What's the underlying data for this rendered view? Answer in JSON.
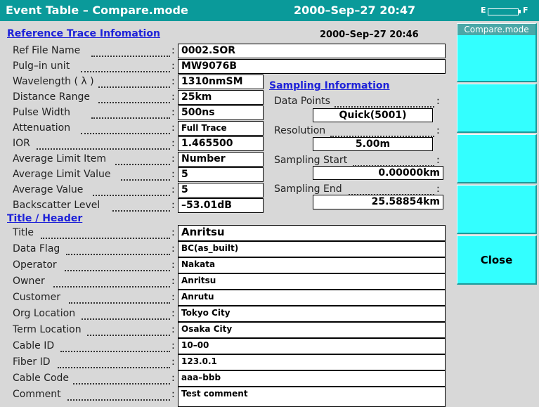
{
  "titlebar": {
    "title": "Event Table – Compare.mode",
    "datetime": "2000–Sep–27 20:47",
    "battery": {
      "left": "E",
      "right": "F"
    }
  },
  "reference": {
    "heading": "Reference Trace Infomation",
    "date": "2000–Sep–27  20:46",
    "fields": [
      {
        "label": "Ref File Name",
        "value": "0002.SOR"
      },
      {
        "label": "Pulg–in unit",
        "value": "MW9076B"
      },
      {
        "label": "Wavelength ( λ )",
        "value": "1310nmSM"
      },
      {
        "label": "Distance Range",
        "value": "25km"
      },
      {
        "label": "Pulse Width",
        "value": "500ns"
      },
      {
        "label": "Attenuation",
        "value": "Full Trace"
      },
      {
        "label": "IOR",
        "value": "1.465500"
      },
      {
        "label": "Average Limit Item",
        "value": "Number"
      },
      {
        "label": "Average Limit Value",
        "value": "5"
      },
      {
        "label": "Average Value",
        "value": "5"
      },
      {
        "label": "Backscatter Level",
        "value": "–53.01dB"
      }
    ]
  },
  "sampling": {
    "heading": "Sampling Information",
    "fields": [
      {
        "label": "Data Points",
        "value": "Quick(5001)"
      },
      {
        "label": "Resolution",
        "value": "5.00m"
      },
      {
        "label": "Sampling Start",
        "value": "0.00000km"
      },
      {
        "label": "Sampling End",
        "value": "25.58854km"
      }
    ]
  },
  "header": {
    "heading": "Title / Header",
    "fields": [
      {
        "label": "Title",
        "value": "Anritsu"
      },
      {
        "label": "Data Flag",
        "value": "BC(as_built)"
      },
      {
        "label": "Operator",
        "value": "Nakata"
      },
      {
        "label": "Owner",
        "value": "Anritsu"
      },
      {
        "label": "Customer",
        "value": "Anrutu"
      },
      {
        "label": "Org Location",
        "value": "Tokyo City"
      },
      {
        "label": "Term Location",
        "value": "Osaka City"
      },
      {
        "label": "Cable ID",
        "value": "10–00"
      },
      {
        "label": "Fiber ID",
        "value": "123.0.1"
      },
      {
        "label": "Cable Code",
        "value": "aaa–bbb"
      },
      {
        "label": "Comment",
        "value": "Test comment"
      }
    ]
  },
  "softkeys": {
    "title": "Compare.mode",
    "keys": [
      "",
      "",
      "",
      "",
      "Close"
    ]
  },
  "colors": {
    "titlebar": "#0a9a9a",
    "softkey": "#33ffff",
    "section_heading": "#1e22d8",
    "background": "#d8d8d8"
  }
}
